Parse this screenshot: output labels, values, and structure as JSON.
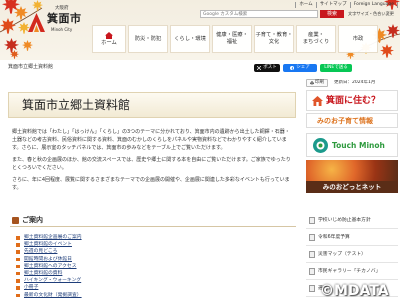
{
  "header": {
    "prefecture": "大阪府",
    "city_name": "箕面市",
    "city_name_en": "Minoh City",
    "top_links": [
      "ホーム",
      "サイトマップ",
      "Foreign Language"
    ],
    "accessibility_link": "文字サイズ・色合い変更",
    "search": {
      "placeholder": "Google カスタム検索",
      "button_label": "検索"
    }
  },
  "nav": [
    {
      "icon": "home-icon",
      "lines": [
        "ホーム"
      ]
    },
    {
      "lines": [
        "防災・防犯"
      ]
    },
    {
      "lines": [
        "くらし・環境"
      ]
    },
    {
      "lines": [
        "健康・医療・",
        "福祉"
      ]
    },
    {
      "lines": [
        "子育て・教育・",
        "文化"
      ]
    },
    {
      "lines": [
        "産業・",
        "まちづくり"
      ]
    },
    {
      "lines": [
        "市政"
      ]
    }
  ],
  "breadcrumb": {
    "current": "箕面市立郷土資料館"
  },
  "share": {
    "x_icon": "x-logo-icon",
    "x_label": "ポスト",
    "facebook_icon": "facebook-icon",
    "facebook_label": "シェア",
    "line_label": "LINEで送る"
  },
  "page_meta": {
    "print_icon": "printer-icon",
    "print_label": "印刷",
    "updated": "更新日：2024年1月"
  },
  "main": {
    "title": "箕面市立郷土資料館",
    "paragraphs": [
      "郷土資料館では「わたし」「はっけん」「くらし」の3つのテーマに分かれており、箕面市内の遺跡から出土した銅鐸・石器・土器などの考古資料、民俗資料に関する資料、箕面のむかしのくらしをパネルや実物資料などでわかりやすく紹介しています。さらに、展示室のタッチパネルでは、箕面市の歩みなどをテーブル上でご覧いただけます。",
      "また、春と秋の企画展のほか、館の交流スペースでは、歴史や郷土に関する本を自由にご覧いただけます。ご家族でゆったりとくつろいでください。",
      "さらに、年に4回程度、展覧に関するさまざまなテーマでの企画展の開催や、企画展に関連した多彩なイベントも行っています。"
    ],
    "guide": {
      "heading": "ご案内",
      "links": [
        "郷土資料館企画展のご案内",
        "郷土資料館のイベント",
        "先週の見どころ",
        "開館時間および休館日",
        "郷土資料館へのアクセス",
        "郷土資料館の資料",
        "ハイキング・ウォーキング",
        "小冊子",
        "最新の文化財（発掘調査）"
      ]
    }
  },
  "sidebar": {
    "banners": {
      "live": "箕面に住む？",
      "kosodate": "みのお子育て情報",
      "touch": "Touch Minoh",
      "dotnet": "みのおどっとネット"
    },
    "links": [
      "学校いじめ防止基本方針",
      "令和6年度予算",
      "災害マップ（テスト）",
      "市民ギャラリー「チカノバ」",
      "選挙"
    ]
  },
  "watermark": "©MDATA",
  "colors": {
    "brand_red": "#c8161d",
    "link_blue": "#1f3e7a",
    "leaf_red": "#d7301f",
    "leaf_orange": "#ef8a25",
    "leaf_yellow": "#f2b233",
    "touch_green": "#2e9a3e",
    "line_green": "#06c755",
    "facebook_blue": "#1877f2"
  }
}
